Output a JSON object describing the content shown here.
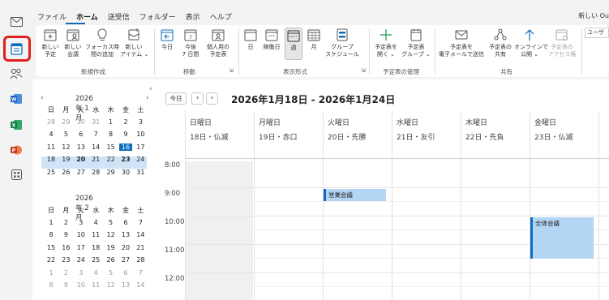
{
  "menubar": {
    "items": [
      "ファイル",
      "ホーム",
      "送受信",
      "フォルダー",
      "表示",
      "ヘルプ"
    ],
    "active": "ホーム",
    "right_label": "新しい Ou"
  },
  "ribbon": {
    "buttons": [
      {
        "label": "新しい\n予定",
        "icon": "calendar-new-icon"
      },
      {
        "label": "新しい\n会議",
        "icon": "meeting-new-icon"
      },
      {
        "label": "フォーカス時\n間の追加",
        "icon": "lightbulb-icon"
      },
      {
        "label": "新しい\nアイテム ⌄",
        "icon": "new-item-icon"
      },
      {
        "label": "今日",
        "icon": "arrow-left-icon"
      },
      {
        "label": "今後\n7 日間",
        "icon": "calendar-7-icon"
      },
      {
        "label": "個人用の\n予定表",
        "icon": "personal-calendar-icon"
      },
      {
        "label": "日",
        "icon": "day-view-icon"
      },
      {
        "label": "稼働日",
        "icon": "workweek-view-icon"
      },
      {
        "label": "週",
        "icon": "week-view-icon"
      },
      {
        "label": "月",
        "icon": "month-view-icon"
      },
      {
        "label": "グループ\nスケジュール",
        "icon": "group-schedule-icon"
      },
      {
        "label": "予定表を\n開く ⌄",
        "icon": "plus-icon"
      },
      {
        "label": "予定表\nグループ ⌄",
        "icon": "calendar-group-icon"
      },
      {
        "label": "予定表を\n電子メールで送信",
        "icon": "mail-icon"
      },
      {
        "label": "予定表の\n共有",
        "icon": "share-icon"
      },
      {
        "label": "オンラインで\n公開 ⌄",
        "icon": "publish-icon"
      },
      {
        "label": "予定表の\nアクセス権",
        "icon": "permissions-icon"
      }
    ],
    "groups": [
      "新規作成",
      "移動",
      "表示形式",
      "予定表の管理",
      "共有"
    ],
    "right_snippet": "ユーザ"
  },
  "mini_calendars": [
    {
      "title": "2026年 1月",
      "dow": [
        "日",
        "月",
        "火",
        "水",
        "木",
        "金",
        "土"
      ],
      "weeks": [
        [
          "28",
          "29",
          "30",
          "31",
          "1",
          "2",
          "3"
        ],
        [
          "4",
          "5",
          "6",
          "7",
          "8",
          "9",
          "10"
        ],
        [
          "11",
          "12",
          "13",
          "14",
          "15",
          "16",
          "17"
        ],
        [
          "18",
          "19",
          "20",
          "21",
          "22",
          "23",
          "24"
        ],
        [
          "25",
          "26",
          "27",
          "28",
          "29",
          "30",
          "31"
        ]
      ]
    },
    {
      "title": "2026年 2月",
      "dow": [
        "日",
        "月",
        "火",
        "水",
        "木",
        "金",
        "土"
      ],
      "weeks": [
        [
          "1",
          "2",
          "3",
          "4",
          "5",
          "6",
          "7"
        ],
        [
          "8",
          "9",
          "10",
          "11",
          "12",
          "13",
          "14"
        ],
        [
          "15",
          "16",
          "17",
          "18",
          "19",
          "20",
          "21"
        ],
        [
          "22",
          "23",
          "24",
          "25",
          "26",
          "27",
          "28"
        ],
        [
          "1",
          "2",
          "3",
          "4",
          "5",
          "6",
          "7"
        ],
        [
          "8",
          "9",
          "10",
          "11",
          "12",
          "13",
          "14"
        ]
      ]
    }
  ],
  "calendar": {
    "today_label": "今日",
    "range_title": "2026年1月18日 - 2026年1月24日",
    "days": [
      {
        "name": "日曜日",
        "date": "18日・仏滅"
      },
      {
        "name": "月曜日",
        "date": "19日・赤口"
      },
      {
        "name": "火曜日",
        "date": "20日・先勝"
      },
      {
        "name": "水曜日",
        "date": "21日・友引"
      },
      {
        "name": "木曜日",
        "date": "22日・先負"
      },
      {
        "name": "金曜日",
        "date": "23日・仏滅"
      }
    ],
    "times": [
      "8:00",
      "9:00",
      "10:00",
      "11:00",
      "12:00"
    ],
    "events": [
      {
        "title": "営業会議",
        "day": 2,
        "start": "9:00",
        "end": "9:30"
      },
      {
        "title": "全体会議",
        "day": 5,
        "start": "10:00",
        "end": "11:30"
      }
    ]
  },
  "colors": {
    "accent": "#0f6cbd",
    "event_fill": "#b4d6f5",
    "highlight_box": "#e0201a"
  }
}
